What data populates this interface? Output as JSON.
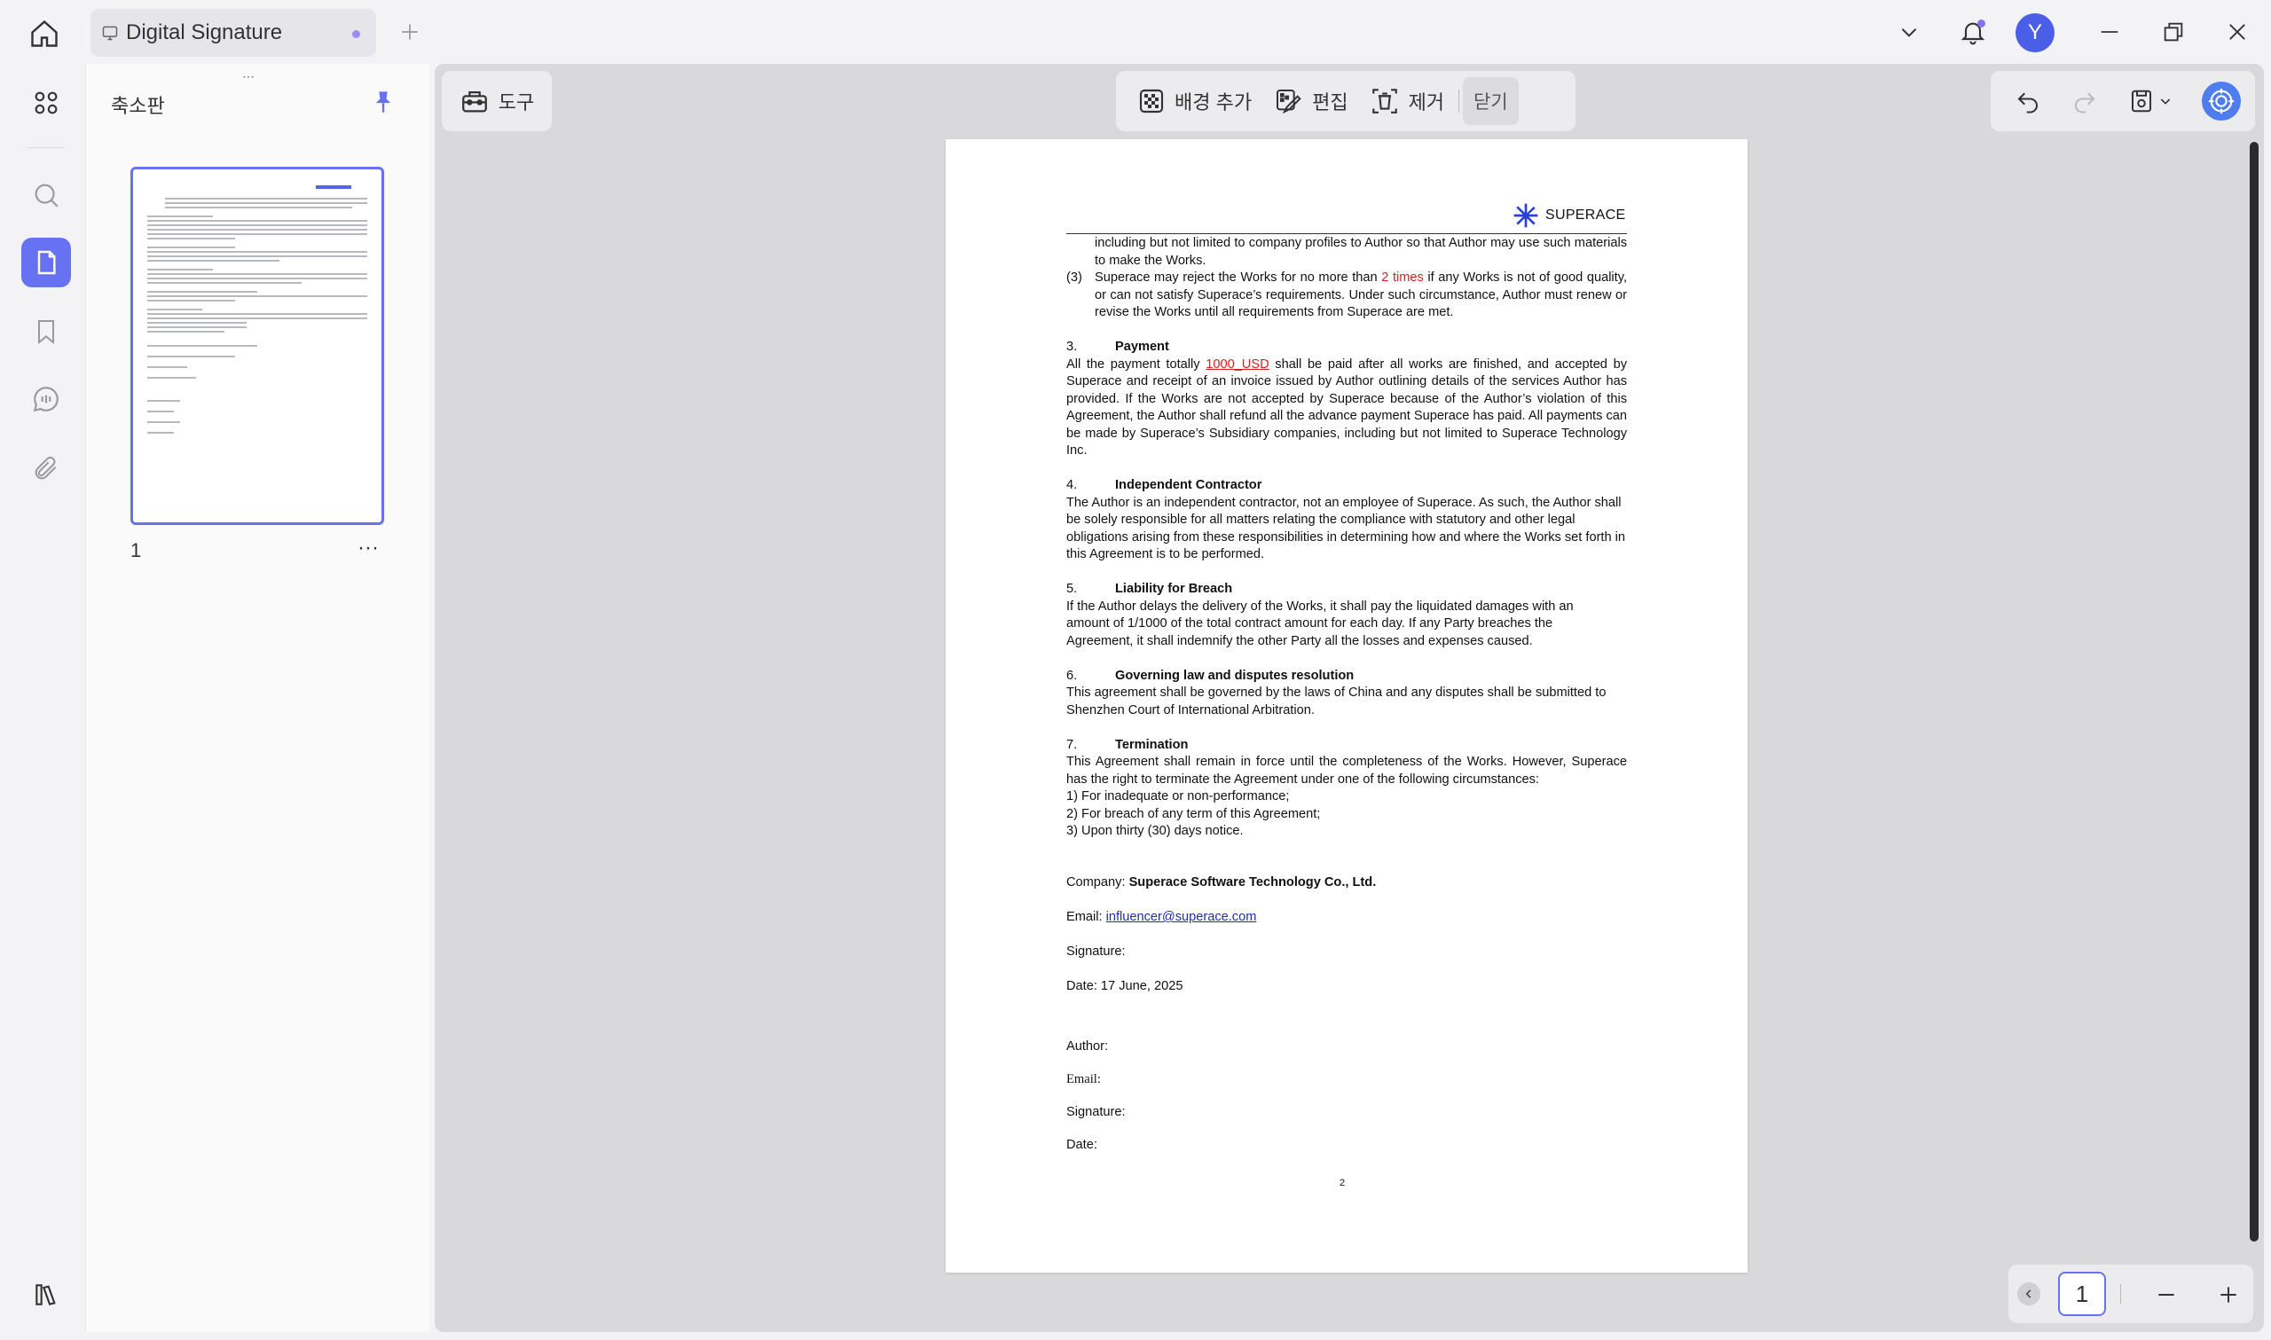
{
  "tab": {
    "title": "Digital Signature"
  },
  "user": {
    "initial": "Y"
  },
  "sidebar": {
    "title": "축소판",
    "page_label": "1",
    "more": "···",
    "handle": "⋯"
  },
  "toolbar": {
    "tools_label": "도구",
    "add_background": "배경 추가",
    "edit": "편집",
    "remove": "제거",
    "close": "닫기"
  },
  "doc": {
    "logo_text": "SUPERACE",
    "cont_line": "including but not limited to company profiles to Author so that Author may use such materials to make the Works.",
    "item3_num": "(3)",
    "item3_pre": "Superace may reject the Works for no more than ",
    "item3_red": "2 times",
    "item3_post": " if any Works is not of good quality, or can not satisfy Superace’s requirements. Under such circumstance, Author must renew or revise the Works until all requirements from Superace are met.",
    "s3_num": "3.",
    "s3_title": "Payment",
    "s3_pre": "All the payment totally ",
    "s3_red": "1000_USD",
    "s3_post": " shall be paid after all works are finished, and accepted by Superace and receipt of an invoice issued by Author outlining details of the services Author has provided. If the Works are not accepted by Superace because of the Author’s violation of this Agreement, the Author shall refund all the advance payment Superace has paid. All payments can be made by Superace’s Subsidiary companies, including but not limited to Superace Technology Inc.",
    "s4_num": "4.",
    "s4_title": "Independent Contractor",
    "s4_body": "The Author is an independent contractor, not an employee of Superace. As such, the Author shall be solely responsible for all matters relating the compliance with statutory and other legal obligations arising from these responsibilities in determining how and where the Works set forth in this Agreement is to be performed.",
    "s5_num": "5.",
    "s5_title": "Liability for Breach",
    "s5_l1": "If the Author delays the delivery of the Works, it shall pay the liquidated damages with an",
    "s5_l2": "amount of 1/1000 of the total contract amount for each day. If any Party breaches the",
    "s5_l3": "Agreement, it shall indemnify the other Party all the losses and expenses caused.",
    "s6_num": "6.",
    "s6_title": "Governing law and disputes resolution",
    "s6_l1": "This agreement shall be governed by the laws of China and any disputes shall be submitted to",
    "s6_l2": "Shenzhen Court of International Arbitration.",
    "s7_num": "7.",
    "s7_title": "Termination",
    "s7_body": "This Agreement shall remain in force until the completeness of the Works. However, Superace has the right to terminate the Agreement under one of the following circumstances:",
    "s7_c1": "1) For inadequate or non-performance;",
    "s7_c2": "2) For breach of any term of this Agreement;",
    "s7_c3": "3)  Upon thirty (30) days notice.",
    "company_label": "Company: ",
    "company_value": "Superace Software Technology Co., Ltd.",
    "email_label": "Email: ",
    "email_value": "influencer@superace.com",
    "signature_label": "Signature:",
    "date_label": "Date: 17 June, 2025",
    "author_label": "Author:",
    "author_email_label": "Email:",
    "author_signature_label": "Signature:",
    "author_date_label": "Date:",
    "page_number": "2"
  },
  "zoom": {
    "current_page": "1"
  },
  "colors": {
    "accent": "#6672f2",
    "avatar": "#4a5ee8",
    "highlight": "#d82020",
    "link": "#1a2fb0"
  }
}
